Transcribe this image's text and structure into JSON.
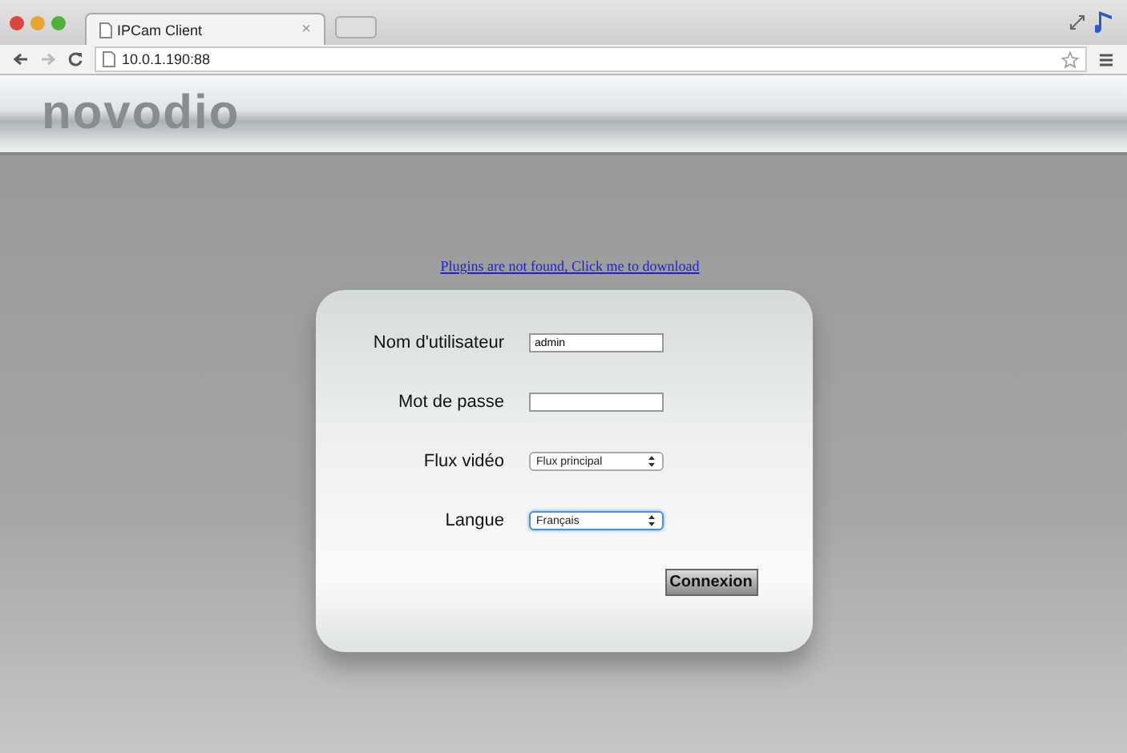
{
  "browser": {
    "tab": {
      "title": "IPCam Client",
      "close": "×"
    },
    "url": "10.0.1.190:88"
  },
  "header": {
    "logo": "novodio"
  },
  "plugin_link": "Plugins are not found, Click me to download",
  "form": {
    "fields": [
      {
        "label": "Nom d'utilisateur",
        "kind": "text",
        "value": "admin",
        "focused": false
      },
      {
        "label": "Mot de passe",
        "kind": "password",
        "focused": false
      },
      {
        "label": "Flux vidéo",
        "kind": "select",
        "value": "Flux principal",
        "focused": false
      },
      {
        "label": "Langue",
        "kind": "select",
        "value": "Français",
        "focused": true
      }
    ],
    "submit": "Connexion"
  }
}
